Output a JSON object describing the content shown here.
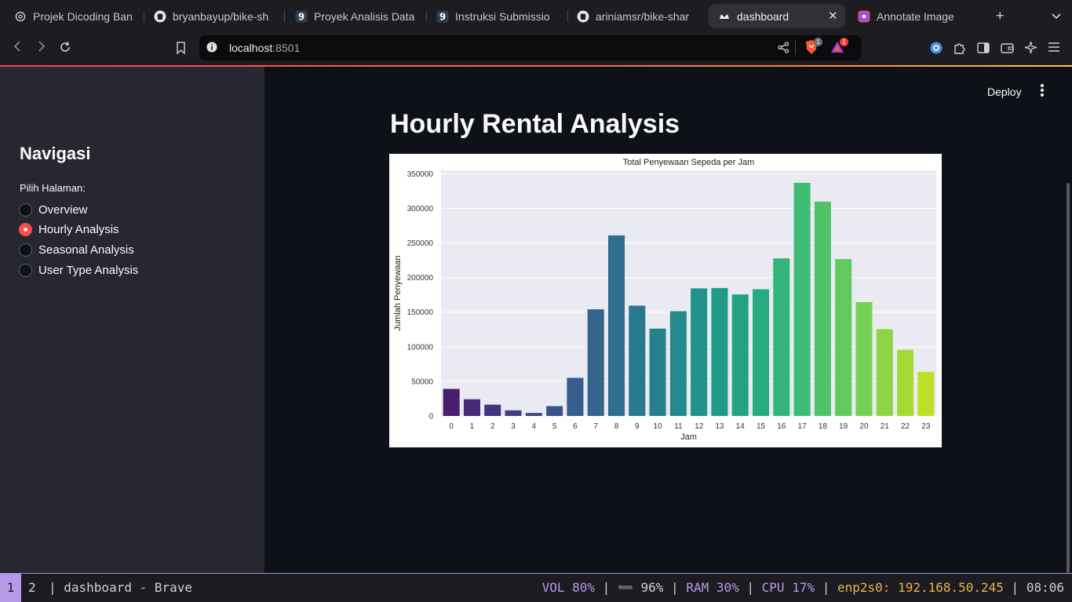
{
  "browser": {
    "tabs": [
      {
        "label": "Projek Dicoding Ban",
        "icon": "openai-icon"
      },
      {
        "label": "bryanbayup/bike-sh",
        "icon": "github-icon"
      },
      {
        "label": "Proyek Analisis Data",
        "icon": "dicoding-icon"
      },
      {
        "label": "Instruksi Submissio",
        "icon": "dicoding-icon"
      },
      {
        "label": "ariniamsr/bike-shar",
        "icon": "github-icon"
      },
      {
        "label": "dashboard",
        "icon": "streamlit-icon",
        "active": true
      },
      {
        "label": "Annotate Image",
        "icon": "annotate-icon"
      }
    ],
    "url_host": "localhost",
    "url_port": ":8501",
    "brave_badge": "1",
    "rewards_badge": "1"
  },
  "sidebar": {
    "title": "Navigasi",
    "radio_label": "Pilih Halaman:",
    "options": [
      "Overview",
      "Hourly Analysis",
      "Seasonal Analysis",
      "User Type Analysis"
    ],
    "selected_index": 1
  },
  "main": {
    "deploy_label": "Deploy",
    "page_title": "Hourly Rental Analysis"
  },
  "chart_data": {
    "type": "bar",
    "title": "Total Penyewaan Sepeda per Jam",
    "xlabel": "Jam",
    "ylabel": "Jumlah Penyewaan",
    "categories": [
      "0",
      "1",
      "2",
      "3",
      "4",
      "5",
      "6",
      "7",
      "8",
      "9",
      "10",
      "11",
      "12",
      "13",
      "14",
      "15",
      "16",
      "17",
      "18",
      "19",
      "20",
      "21",
      "22",
      "23"
    ],
    "values": [
      39130,
      24164,
      16352,
      8174,
      4428,
      14261,
      55132,
      154171,
      261001,
      159438,
      126257,
      151320,
      184414,
      184919,
      175652,
      183149,
      227748,
      336860,
      309772,
      226789,
      164550,
      125445,
      95612,
      63941
    ],
    "ylim": [
      0,
      355000
    ],
    "yticks": [
      0,
      50000,
      100000,
      150000,
      200000,
      250000,
      300000,
      350000
    ],
    "palette": "viridis",
    "background": "#eaeaf2",
    "grid": true
  },
  "taskbar": {
    "workspace_1": "1",
    "workspace_2": "2",
    "window_title": "| dashboard - Brave",
    "vol": "VOL 80%",
    "battery": "➖ 96%",
    "ram": "RAM 30%",
    "cpu": "CPU 17%",
    "net": "enp2s0: 192.168.50.245",
    "time": "08:06",
    "sep": " | "
  }
}
